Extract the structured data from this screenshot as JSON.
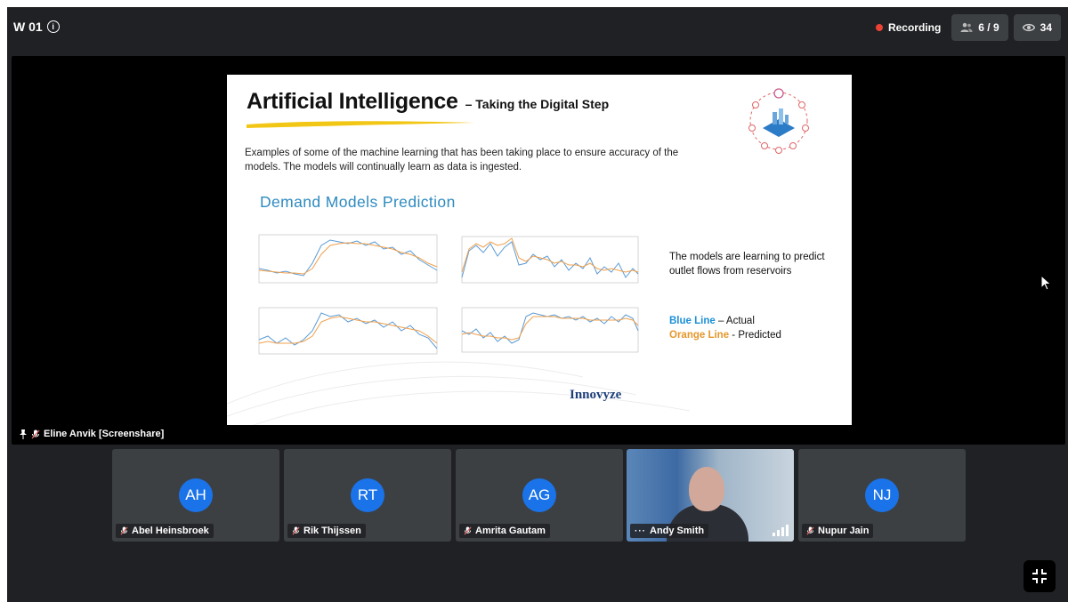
{
  "meeting": {
    "title": "W 01",
    "recording_label": "Recording",
    "participants_count": "6 / 9",
    "viewers_count": "34",
    "colors": {
      "recording": "#ea4335",
      "avatar": "#1a73e8",
      "background": "#202124",
      "tile": "#3c4043"
    }
  },
  "stage": {
    "presenter_label": "Eline Anvik [Screenshare]",
    "slide": {
      "title": "Artificial Intelligence",
      "subtitle": "– Taking the Digital Step",
      "body": "Examples of some of the machine learning that has been taking place to ensure accuracy of the models. The models will continually learn as data is ingested.",
      "section_heading": "Demand Models Prediction",
      "note": "The models are learning to predict outlet flows from reservoirs",
      "legend_blue": "Blue Line",
      "legend_blue_rest": " – Actual",
      "legend_orange": "Orange Line",
      "legend_orange_rest": " - Predicted",
      "brand": "Innovyze",
      "colors": {
        "actual": "#5b9bd5",
        "predicted": "#f0a04b",
        "heading": "#2e8bc0"
      }
    }
  },
  "participants": [
    {
      "initials": "AH",
      "name": "Abel Heinsbroek",
      "muted": true
    },
    {
      "initials": "RT",
      "name": "Rik Thijssen",
      "muted": true
    },
    {
      "initials": "AG",
      "name": "Amrita Gautam",
      "muted": true
    },
    {
      "initials": "",
      "name": "Andy Smith",
      "muted": false,
      "video": true
    },
    {
      "initials": "NJ",
      "name": "Nupur Jain",
      "muted": true
    }
  ]
}
